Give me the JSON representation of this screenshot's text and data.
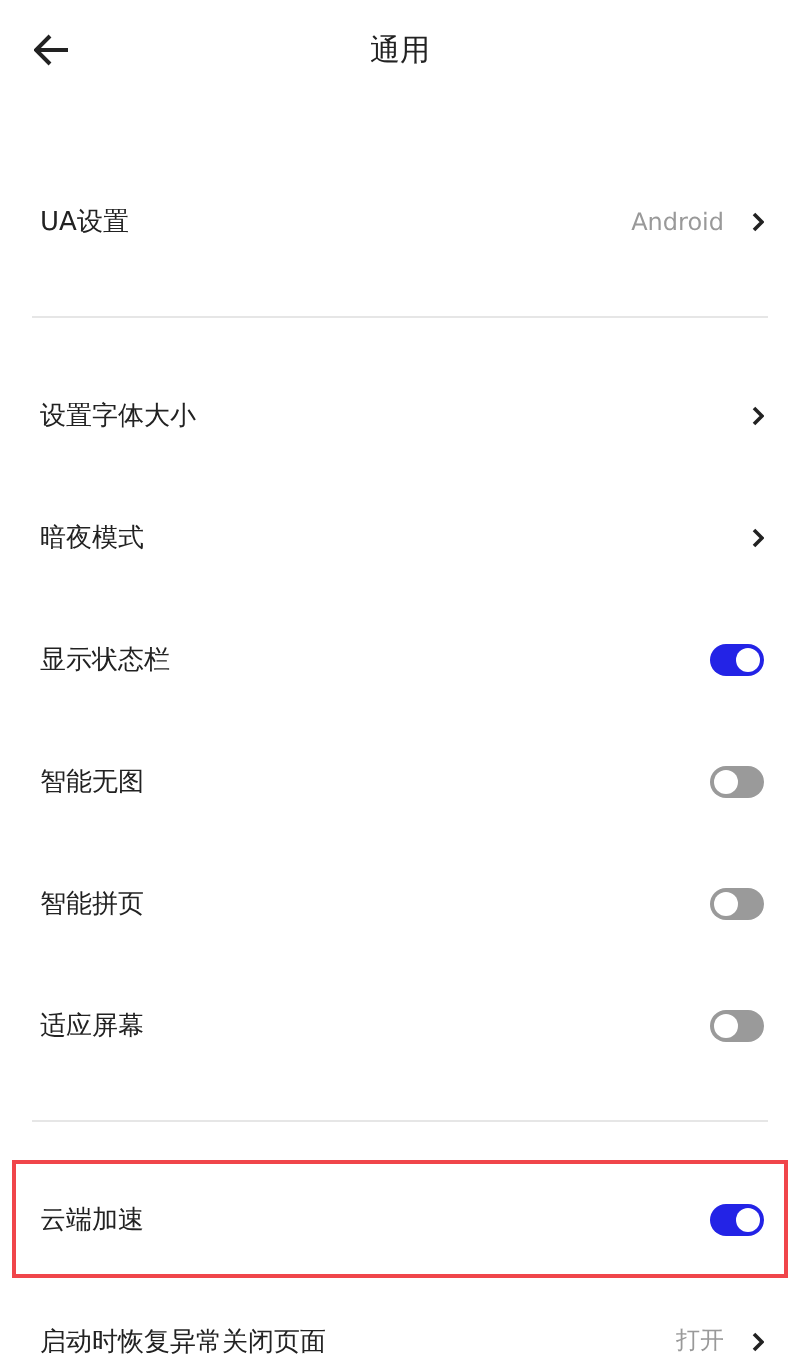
{
  "header": {
    "title": "通用"
  },
  "sections": [
    {
      "items": [
        {
          "kind": "link",
          "label": "UA设置",
          "value": "Android",
          "highlighted": false
        }
      ]
    },
    {
      "items": [
        {
          "kind": "link",
          "label": "设置字体大小",
          "highlighted": false
        },
        {
          "kind": "link",
          "label": "暗夜模式",
          "highlighted": false
        },
        {
          "kind": "toggle",
          "label": "显示状态栏",
          "on": true,
          "highlighted": false
        },
        {
          "kind": "toggle",
          "label": "智能无图",
          "on": false,
          "highlighted": false
        },
        {
          "kind": "toggle",
          "label": "智能拼页",
          "on": false,
          "highlighted": false
        },
        {
          "kind": "toggle",
          "label": "适应屏幕",
          "on": false,
          "highlighted": false
        }
      ]
    },
    {
      "items": [
        {
          "kind": "toggle",
          "label": "云端加速",
          "on": true,
          "highlighted": true
        },
        {
          "kind": "link",
          "label": "启动时恢复异常关闭页面",
          "value": "打开",
          "highlighted": false
        }
      ]
    }
  ]
}
